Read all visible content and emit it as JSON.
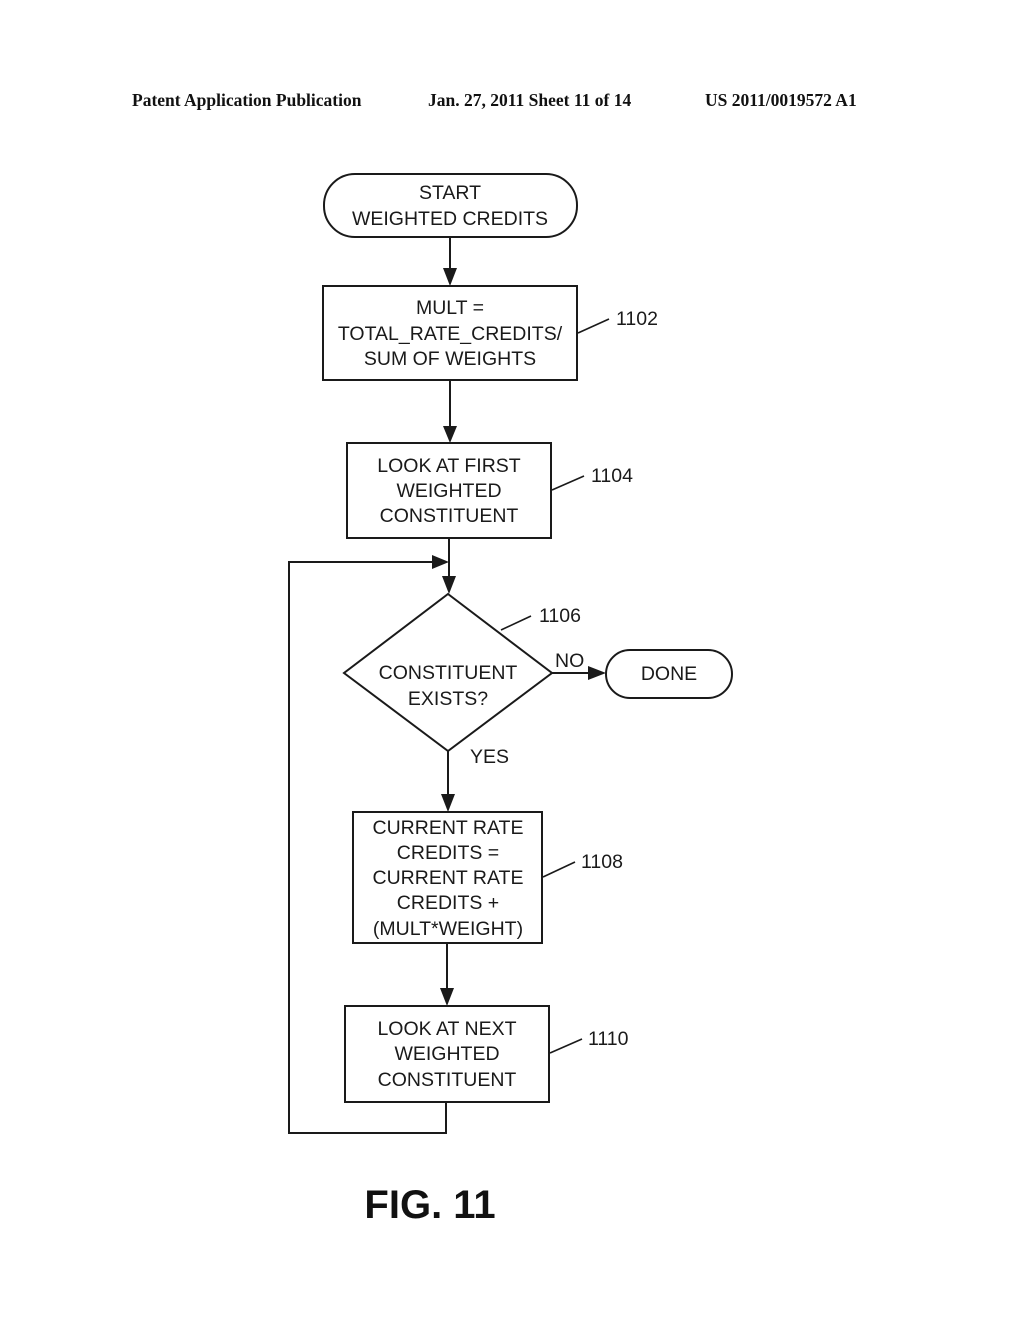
{
  "header": {
    "left": "Patent Application Publication",
    "middle": "Jan. 27, 2011  Sheet 11 of 14",
    "right": "US 2011/0019572 A1"
  },
  "flowchart": {
    "start": {
      "lines": [
        "START",
        "WEIGHTED CREDITS"
      ]
    },
    "step_1102": {
      "ref": "1102",
      "lines": [
        "MULT =",
        "TOTAL_RATE_CREDITS/",
        "SUM OF WEIGHTS"
      ]
    },
    "step_1104": {
      "ref": "1104",
      "lines": [
        "LOOK AT FIRST",
        "WEIGHTED",
        "CONSTITUENT"
      ]
    },
    "decision_1106": {
      "ref": "1106",
      "lines": [
        "CONSTITUENT",
        "EXISTS?"
      ],
      "no_label": "NO",
      "yes_label": "YES"
    },
    "done": {
      "label": "DONE"
    },
    "step_1108": {
      "ref": "1108",
      "lines": [
        "CURRENT RATE",
        "CREDITS =",
        "CURRENT RATE",
        "CREDITS +",
        "(MULT*WEIGHT)"
      ]
    },
    "step_1110": {
      "ref": "1110",
      "lines": [
        "LOOK AT NEXT",
        "WEIGHTED",
        "CONSTITUENT"
      ]
    }
  },
  "figure_label": "FIG. 11"
}
